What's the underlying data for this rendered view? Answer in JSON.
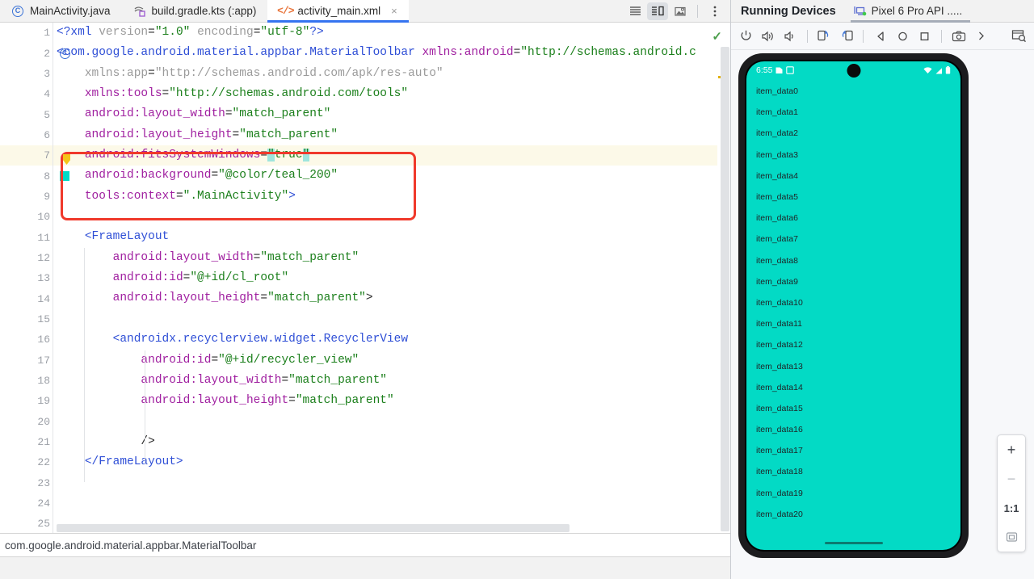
{
  "editor": {
    "tabs": [
      {
        "label": "MainActivity.java",
        "icon": "java-class-icon",
        "active": false,
        "closable": false
      },
      {
        "label": "build.gradle.kts (:app)",
        "icon": "gradle-script-icon",
        "active": false,
        "closable": false
      },
      {
        "label": "activity_main.xml",
        "icon": "xml-file-icon",
        "active": true,
        "closable": true,
        "close_label": "×"
      }
    ],
    "tab_actions": [
      {
        "name": "list-view-icon",
        "selected": false
      },
      {
        "name": "split-view-icon",
        "selected": true
      },
      {
        "name": "design-preview-icon",
        "selected": false
      },
      {
        "name": "more-options-icon",
        "selected": false
      }
    ],
    "inspection_status": "✓",
    "lines": [
      {
        "n": "1",
        "marker": "",
        "current": false,
        "tokens": [
          {
            "t": "<?xml ",
            "c": "k-pi"
          },
          {
            "t": "version",
            "c": "k-attr2"
          },
          {
            "t": "=",
            "c": "k-punct"
          },
          {
            "t": "\"1.0\"",
            "c": "k-val"
          },
          {
            "t": " ",
            "c": "k-punct"
          },
          {
            "t": "encoding",
            "c": "k-attr2"
          },
          {
            "t": "=",
            "c": "k-punct"
          },
          {
            "t": "\"utf-8\"",
            "c": "k-val"
          },
          {
            "t": "?>",
            "c": "k-pi"
          }
        ],
        "indent": 0
      },
      {
        "n": "2",
        "marker": "class-icon",
        "current": false,
        "tokens": [
          {
            "t": "<com.google.android.material.appbar.MaterialToolbar",
            "c": "k-tag"
          },
          {
            "t": " ",
            "c": "k-punct"
          },
          {
            "t": "xmlns:android",
            "c": "k-attr"
          },
          {
            "t": "=",
            "c": "k-punct"
          },
          {
            "t": "\"http://schemas.android.c",
            "c": "k-val"
          }
        ],
        "indent": 0
      },
      {
        "n": "3",
        "marker": "",
        "current": false,
        "tokens": [
          {
            "t": "    ",
            "c": "k-punct"
          },
          {
            "t": "xmlns:app",
            "c": "k-attr2"
          },
          {
            "t": "=",
            "c": "k-punct"
          },
          {
            "t": "\"http://schemas.android.com/apk/res-auto\"",
            "c": "k-attr2"
          }
        ],
        "indent": 0
      },
      {
        "n": "4",
        "marker": "",
        "current": false,
        "tokens": [
          {
            "t": "    ",
            "c": "k-punct"
          },
          {
            "t": "xmlns:tools",
            "c": "k-attr"
          },
          {
            "t": "=",
            "c": "k-punct"
          },
          {
            "t": "\"http://schemas.android.com/tools\"",
            "c": "k-val"
          }
        ],
        "indent": 0
      },
      {
        "n": "5",
        "marker": "",
        "current": false,
        "tokens": [
          {
            "t": "    ",
            "c": "k-punct"
          },
          {
            "t": "android:layout_width",
            "c": "k-attr"
          },
          {
            "t": "=",
            "c": "k-punct"
          },
          {
            "t": "\"match_parent\"",
            "c": "k-val"
          }
        ],
        "indent": 0
      },
      {
        "n": "6",
        "marker": "",
        "current": false,
        "tokens": [
          {
            "t": "    ",
            "c": "k-punct"
          },
          {
            "t": "android:layout_height",
            "c": "k-attr"
          },
          {
            "t": "=",
            "c": "k-punct"
          },
          {
            "t": "\"match_parent\"",
            "c": "k-val"
          }
        ],
        "indent": 0
      },
      {
        "n": "7",
        "marker": "",
        "current": true,
        "tokens": [
          {
            "t": "    ",
            "c": "k-punct"
          },
          {
            "t": "android:fitsSystemWindows",
            "c": "k-attr"
          },
          {
            "t": "=",
            "c": "k-punct"
          },
          {
            "t": "\"",
            "c": "k-val sel-hl"
          },
          {
            "t": "true",
            "c": "k-val"
          },
          {
            "t": "\"",
            "c": "k-val sel-hl"
          }
        ],
        "indent": 0
      },
      {
        "n": "8",
        "marker": "color-swatch",
        "current": false,
        "tokens": [
          {
            "t": "    ",
            "c": "k-punct"
          },
          {
            "t": "android:background",
            "c": "k-attr"
          },
          {
            "t": "=",
            "c": "k-punct"
          },
          {
            "t": "\"@color/teal_200\"",
            "c": "k-val"
          }
        ],
        "indent": 0
      },
      {
        "n": "9",
        "marker": "",
        "current": false,
        "tokens": [
          {
            "t": "    ",
            "c": "k-punct"
          },
          {
            "t": "tools:context",
            "c": "k-attr"
          },
          {
            "t": "=",
            "c": "k-punct"
          },
          {
            "t": "\".MainActivity\"",
            "c": "k-val"
          },
          {
            "t": ">",
            "c": "k-tag"
          }
        ],
        "indent": 0
      },
      {
        "n": "10",
        "marker": "",
        "current": false,
        "tokens": [],
        "indent": 0
      },
      {
        "n": "11",
        "marker": "",
        "current": false,
        "tokens": [
          {
            "t": "    ",
            "c": "k-punct"
          },
          {
            "t": "<FrameLayout",
            "c": "k-tag"
          }
        ],
        "indent": 0
      },
      {
        "n": "12",
        "marker": "",
        "current": false,
        "tokens": [
          {
            "t": "        ",
            "c": "k-punct"
          },
          {
            "t": "android:layout_width",
            "c": "k-attr"
          },
          {
            "t": "=",
            "c": "k-punct"
          },
          {
            "t": "\"match_parent\"",
            "c": "k-val"
          }
        ],
        "indent": 0
      },
      {
        "n": "13",
        "marker": "",
        "current": false,
        "tokens": [
          {
            "t": "        ",
            "c": "k-punct"
          },
          {
            "t": "android:id",
            "c": "k-attr"
          },
          {
            "t": "=",
            "c": "k-punct"
          },
          {
            "t": "\"@+id/cl_root\"",
            "c": "k-val"
          }
        ],
        "indent": 0
      },
      {
        "n": "14",
        "marker": "",
        "current": false,
        "tokens": [
          {
            "t": "        ",
            "c": "k-punct"
          },
          {
            "t": "android:layout_height",
            "c": "k-attr"
          },
          {
            "t": "=",
            "c": "k-punct"
          },
          {
            "t": "\"match_parent\"",
            "c": "k-val"
          },
          {
            "t": ">",
            "c": "k-punct"
          }
        ],
        "indent": 0
      },
      {
        "n": "15",
        "marker": "",
        "current": false,
        "tokens": [],
        "indent": 0
      },
      {
        "n": "16",
        "marker": "",
        "current": false,
        "tokens": [
          {
            "t": "        ",
            "c": "k-punct"
          },
          {
            "t": "<androidx.recyclerview.widget.RecyclerView",
            "c": "k-tag"
          }
        ],
        "indent": 0
      },
      {
        "n": "17",
        "marker": "",
        "current": false,
        "tokens": [
          {
            "t": "            ",
            "c": "k-punct"
          },
          {
            "t": "android:id",
            "c": "k-attr"
          },
          {
            "t": "=",
            "c": "k-punct"
          },
          {
            "t": "\"@+id/recycler_view\"",
            "c": "k-val"
          }
        ],
        "indent": 0
      },
      {
        "n": "18",
        "marker": "",
        "current": false,
        "tokens": [
          {
            "t": "            ",
            "c": "k-punct"
          },
          {
            "t": "android:layout_width",
            "c": "k-attr"
          },
          {
            "t": "=",
            "c": "k-punct"
          },
          {
            "t": "\"match_parent\"",
            "c": "k-val"
          }
        ],
        "indent": 0
      },
      {
        "n": "19",
        "marker": "",
        "current": false,
        "tokens": [
          {
            "t": "            ",
            "c": "k-punct"
          },
          {
            "t": "android:layout_height",
            "c": "k-attr"
          },
          {
            "t": "=",
            "c": "k-punct"
          },
          {
            "t": "\"match_parent\"",
            "c": "k-val"
          }
        ],
        "indent": 0
      },
      {
        "n": "20",
        "marker": "",
        "current": false,
        "tokens": [],
        "indent": 0
      },
      {
        "n": "21",
        "marker": "",
        "current": false,
        "tokens": [
          {
            "t": "            ",
            "c": "k-punct"
          },
          {
            "t": "/>",
            "c": "k-punct"
          }
        ],
        "indent": 0
      },
      {
        "n": "22",
        "marker": "",
        "current": false,
        "tokens": [
          {
            "t": "    ",
            "c": "k-punct"
          },
          {
            "t": "</FrameLayout>",
            "c": "k-tag"
          }
        ],
        "indent": 0
      },
      {
        "n": "23",
        "marker": "",
        "current": false,
        "tokens": [],
        "indent": 0
      },
      {
        "n": "24",
        "marker": "",
        "current": false,
        "tokens": [],
        "indent": 0
      },
      {
        "n": "25",
        "marker": "",
        "current": false,
        "tokens": [],
        "indent": 0
      }
    ]
  },
  "statusbar": {
    "text": "com.google.android.material.appbar.MaterialToolbar"
  },
  "running_devices": {
    "title": "Running Devices",
    "device_tab": {
      "label": "Pixel 6 Pro API .....",
      "icon": "device-running-icon"
    },
    "toolbar": [
      {
        "name": "power-button-icon"
      },
      {
        "name": "volume-up-icon"
      },
      {
        "name": "volume-down-icon"
      },
      {
        "name": "rotate-left-icon"
      },
      {
        "name": "rotate-right-icon"
      },
      {
        "name": "back-button-icon"
      },
      {
        "name": "home-button-icon"
      },
      {
        "name": "overview-button-icon"
      },
      {
        "name": "screenshot-icon"
      },
      {
        "name": "more-actions-chevron-icon"
      },
      {
        "name": "layout-inspector-icon"
      }
    ],
    "zoom_controls": [
      {
        "name": "zoom-in-button",
        "label": "+",
        "enabled": true
      },
      {
        "name": "zoom-out-button",
        "label": "−",
        "enabled": false
      },
      {
        "name": "zoom-actual-size-button",
        "label": "1:1",
        "enabled": true
      },
      {
        "name": "zoom-fit-button",
        "label": "fit-icon",
        "enabled": true
      }
    ]
  },
  "emulator": {
    "background_color": "#03dac5",
    "status_bar": {
      "time": "6:55",
      "left_icons": [
        "sim-card-icon",
        "screenshot-notification-icon"
      ],
      "right_icons": [
        "wifi-icon",
        "cellular-signal-off-icon",
        "battery-icon"
      ]
    },
    "list_items": [
      "item_data0",
      "item_data1",
      "item_data2",
      "item_data3",
      "item_data4",
      "item_data5",
      "item_data6",
      "item_data7",
      "item_data8",
      "item_data9",
      "item_data10",
      "item_data11",
      "item_data12",
      "item_data13",
      "item_data14",
      "item_data15",
      "item_data16",
      "item_data17",
      "item_data18",
      "item_data19",
      "item_data20"
    ]
  }
}
